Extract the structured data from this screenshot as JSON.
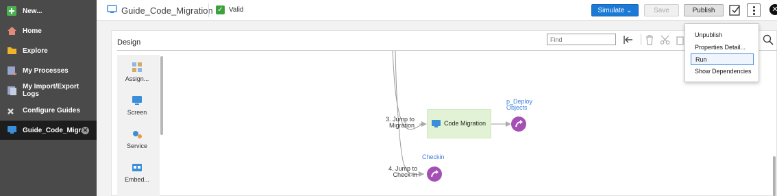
{
  "sidebar": {
    "items": [
      {
        "label": "New...",
        "icon": "plus-icon",
        "color": "#4caf50"
      },
      {
        "label": "Home",
        "icon": "home-icon",
        "color": "#e28a7b"
      },
      {
        "label": "Explore",
        "icon": "folder-icon",
        "color": "#f0b429"
      },
      {
        "label": "My Processes",
        "icon": "processes-icon",
        "color": "#9aa6c9"
      },
      {
        "label": "My Import/Export Logs",
        "icon": "logs-icon",
        "color": "#9aa6c9"
      },
      {
        "label": "Configure Guides",
        "icon": "tools-icon",
        "color": "#cccccc"
      },
      {
        "label": "Guide_Code_Migr...",
        "icon": "guide-icon",
        "color": "#3a8fd8",
        "active": true
      }
    ]
  },
  "header": {
    "title": "Guide_Code_Migration",
    "status": "Valid",
    "simulate_label": "Simulate ⌄",
    "save_label": "Save",
    "publish_label": "Publish"
  },
  "design": {
    "title": "Design",
    "find_placeholder": "Find"
  },
  "palette": {
    "items": [
      {
        "label": "Assign...",
        "icon": "assignment-icon"
      },
      {
        "label": "Screen",
        "icon": "screen-icon"
      },
      {
        "label": "Service",
        "icon": "service-icon"
      },
      {
        "label": "Embed...",
        "icon": "embed-icon"
      }
    ]
  },
  "canvas": {
    "node_label": "Code Migration",
    "jump1": [
      "3. Jump to",
      "Migration"
    ],
    "jump2": [
      "4. Jump to",
      "Check-in"
    ],
    "deploy_label": [
      "p_Deploy",
      "Objects"
    ],
    "checkin_label": "Checkin"
  },
  "menu": {
    "items": [
      {
        "label": "Unpublish"
      },
      {
        "label": "Properties Detail..."
      },
      {
        "label": "Run",
        "highlighted": true
      },
      {
        "label": "Show Dependencies"
      }
    ]
  }
}
